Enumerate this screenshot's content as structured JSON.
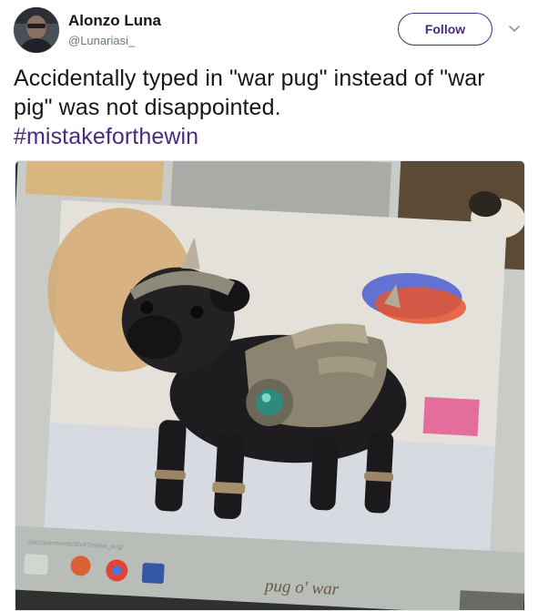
{
  "user": {
    "display_name": "Alonzo Luna",
    "screen_name": "@Lunariasi_",
    "avatar_icon": "user-avatar"
  },
  "actions": {
    "follow_label": "Follow",
    "more_icon": "chevron-down-icon"
  },
  "tweet": {
    "text": "Accidentally typed in \"war pug\" instead of \"war pig\" was not disappointed.",
    "hashtag": "#mistakeforthewin"
  },
  "media": {
    "caption": "pug o' war",
    "url_text": "/pics/comments/3h4t7m/war_pug/"
  },
  "colors": {
    "accent": "#4a2c7f",
    "text": "#14171a",
    "secondary": "#657786"
  }
}
